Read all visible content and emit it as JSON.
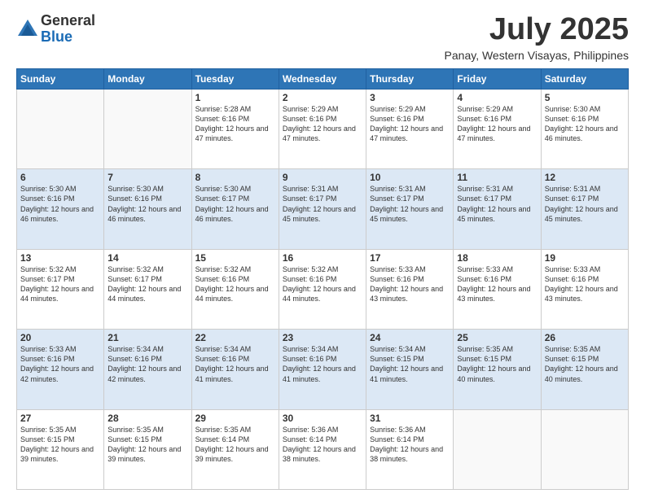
{
  "logo": {
    "general": "General",
    "blue": "Blue"
  },
  "header": {
    "month": "July 2025",
    "location": "Panay, Western Visayas, Philippines"
  },
  "days_of_week": [
    "Sunday",
    "Monday",
    "Tuesday",
    "Wednesday",
    "Thursday",
    "Friday",
    "Saturday"
  ],
  "weeks": [
    [
      {
        "day": "",
        "info": ""
      },
      {
        "day": "",
        "info": ""
      },
      {
        "day": "1",
        "info": "Sunrise: 5:28 AM\nSunset: 6:16 PM\nDaylight: 12 hours and 47 minutes."
      },
      {
        "day": "2",
        "info": "Sunrise: 5:29 AM\nSunset: 6:16 PM\nDaylight: 12 hours and 47 minutes."
      },
      {
        "day": "3",
        "info": "Sunrise: 5:29 AM\nSunset: 6:16 PM\nDaylight: 12 hours and 47 minutes."
      },
      {
        "day": "4",
        "info": "Sunrise: 5:29 AM\nSunset: 6:16 PM\nDaylight: 12 hours and 47 minutes."
      },
      {
        "day": "5",
        "info": "Sunrise: 5:30 AM\nSunset: 6:16 PM\nDaylight: 12 hours and 46 minutes."
      }
    ],
    [
      {
        "day": "6",
        "info": "Sunrise: 5:30 AM\nSunset: 6:16 PM\nDaylight: 12 hours and 46 minutes."
      },
      {
        "day": "7",
        "info": "Sunrise: 5:30 AM\nSunset: 6:16 PM\nDaylight: 12 hours and 46 minutes."
      },
      {
        "day": "8",
        "info": "Sunrise: 5:30 AM\nSunset: 6:17 PM\nDaylight: 12 hours and 46 minutes."
      },
      {
        "day": "9",
        "info": "Sunrise: 5:31 AM\nSunset: 6:17 PM\nDaylight: 12 hours and 45 minutes."
      },
      {
        "day": "10",
        "info": "Sunrise: 5:31 AM\nSunset: 6:17 PM\nDaylight: 12 hours and 45 minutes."
      },
      {
        "day": "11",
        "info": "Sunrise: 5:31 AM\nSunset: 6:17 PM\nDaylight: 12 hours and 45 minutes."
      },
      {
        "day": "12",
        "info": "Sunrise: 5:31 AM\nSunset: 6:17 PM\nDaylight: 12 hours and 45 minutes."
      }
    ],
    [
      {
        "day": "13",
        "info": "Sunrise: 5:32 AM\nSunset: 6:17 PM\nDaylight: 12 hours and 44 minutes."
      },
      {
        "day": "14",
        "info": "Sunrise: 5:32 AM\nSunset: 6:17 PM\nDaylight: 12 hours and 44 minutes."
      },
      {
        "day": "15",
        "info": "Sunrise: 5:32 AM\nSunset: 6:16 PM\nDaylight: 12 hours and 44 minutes."
      },
      {
        "day": "16",
        "info": "Sunrise: 5:32 AM\nSunset: 6:16 PM\nDaylight: 12 hours and 44 minutes."
      },
      {
        "day": "17",
        "info": "Sunrise: 5:33 AM\nSunset: 6:16 PM\nDaylight: 12 hours and 43 minutes."
      },
      {
        "day": "18",
        "info": "Sunrise: 5:33 AM\nSunset: 6:16 PM\nDaylight: 12 hours and 43 minutes."
      },
      {
        "day": "19",
        "info": "Sunrise: 5:33 AM\nSunset: 6:16 PM\nDaylight: 12 hours and 43 minutes."
      }
    ],
    [
      {
        "day": "20",
        "info": "Sunrise: 5:33 AM\nSunset: 6:16 PM\nDaylight: 12 hours and 42 minutes."
      },
      {
        "day": "21",
        "info": "Sunrise: 5:34 AM\nSunset: 6:16 PM\nDaylight: 12 hours and 42 minutes."
      },
      {
        "day": "22",
        "info": "Sunrise: 5:34 AM\nSunset: 6:16 PM\nDaylight: 12 hours and 41 minutes."
      },
      {
        "day": "23",
        "info": "Sunrise: 5:34 AM\nSunset: 6:16 PM\nDaylight: 12 hours and 41 minutes."
      },
      {
        "day": "24",
        "info": "Sunrise: 5:34 AM\nSunset: 6:15 PM\nDaylight: 12 hours and 41 minutes."
      },
      {
        "day": "25",
        "info": "Sunrise: 5:35 AM\nSunset: 6:15 PM\nDaylight: 12 hours and 40 minutes."
      },
      {
        "day": "26",
        "info": "Sunrise: 5:35 AM\nSunset: 6:15 PM\nDaylight: 12 hours and 40 minutes."
      }
    ],
    [
      {
        "day": "27",
        "info": "Sunrise: 5:35 AM\nSunset: 6:15 PM\nDaylight: 12 hours and 39 minutes."
      },
      {
        "day": "28",
        "info": "Sunrise: 5:35 AM\nSunset: 6:15 PM\nDaylight: 12 hours and 39 minutes."
      },
      {
        "day": "29",
        "info": "Sunrise: 5:35 AM\nSunset: 6:14 PM\nDaylight: 12 hours and 39 minutes."
      },
      {
        "day": "30",
        "info": "Sunrise: 5:36 AM\nSunset: 6:14 PM\nDaylight: 12 hours and 38 minutes."
      },
      {
        "day": "31",
        "info": "Sunrise: 5:36 AM\nSunset: 6:14 PM\nDaylight: 12 hours and 38 minutes."
      },
      {
        "day": "",
        "info": ""
      },
      {
        "day": "",
        "info": ""
      }
    ]
  ]
}
